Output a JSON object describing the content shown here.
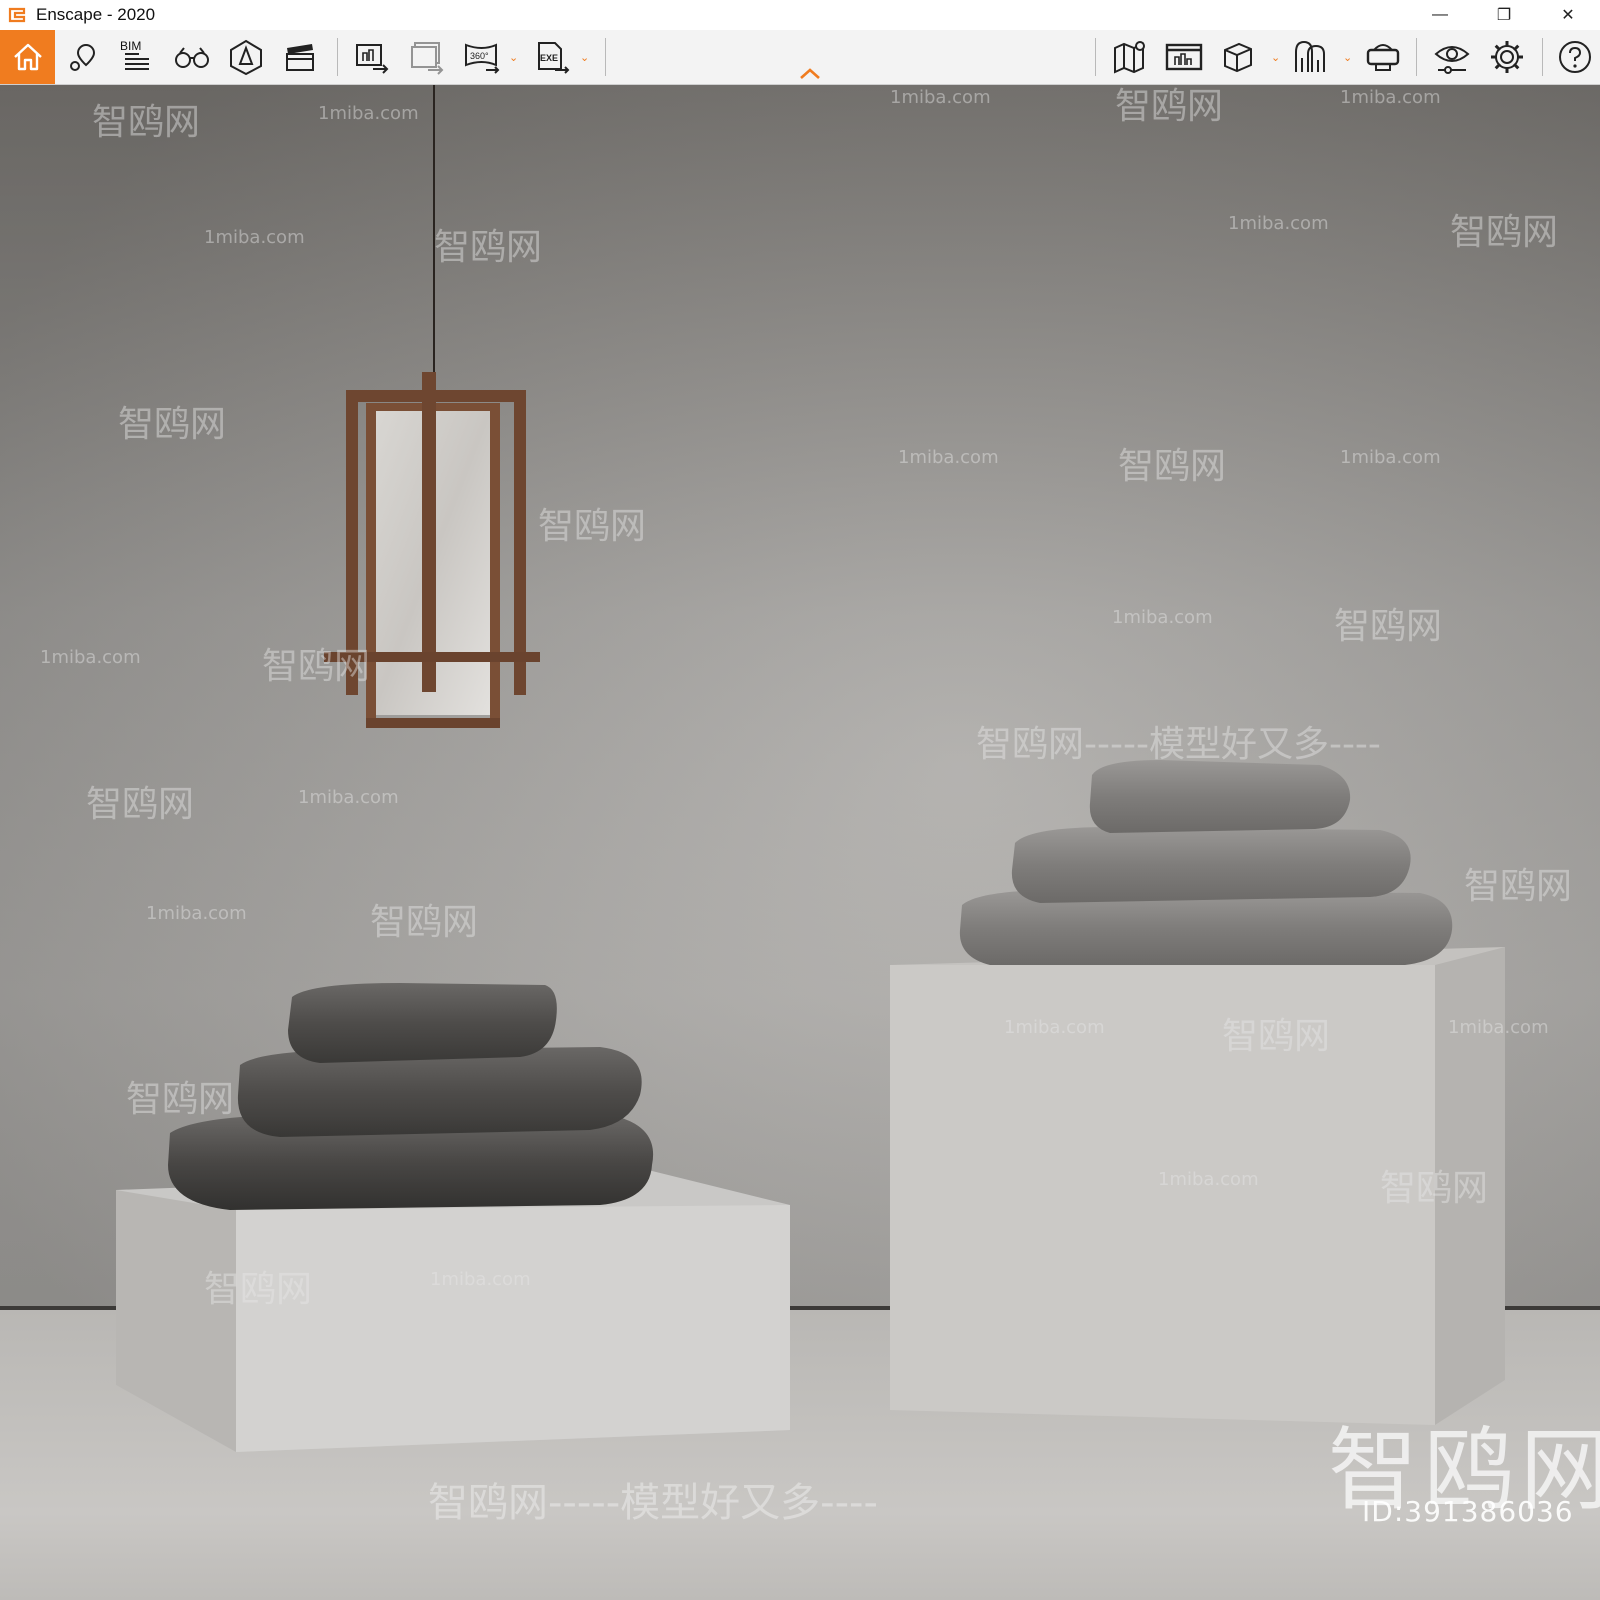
{
  "window": {
    "title": "Enscape - 2020",
    "controls": {
      "minimize": "—",
      "restore": "❐",
      "close": "✕"
    }
  },
  "toolbar": {
    "bim_label": "BIM",
    "accent_color": "#f07c1f",
    "left_icons": [
      "home-icon",
      "location-pin-icon",
      "bim-list-icon",
      "binoculars-icon",
      "light-view-icon",
      "clapperboard-icon",
      "screenshot-export-icon",
      "batch-render-icon",
      "panorama-360-icon",
      "exe-export-icon"
    ],
    "right_icons": [
      "map-icon",
      "monitor-icon",
      "cube-icon",
      "asset-library-icon",
      "vr-headset-icon",
      "visual-settings-icon",
      "settings-icon",
      "help-icon"
    ],
    "panorama_label": "360°",
    "exe_label": "EXE"
  },
  "watermarks": {
    "site": "1miba.com",
    "cn_brand": "智鸥网",
    "slogan": "智鸥网-----模型好又多----",
    "slogan_mid": "智鸥网-----模型好又多----",
    "dash_line": "------",
    "logo_text": "智鸥网",
    "id_text": "ID:391386036"
  }
}
